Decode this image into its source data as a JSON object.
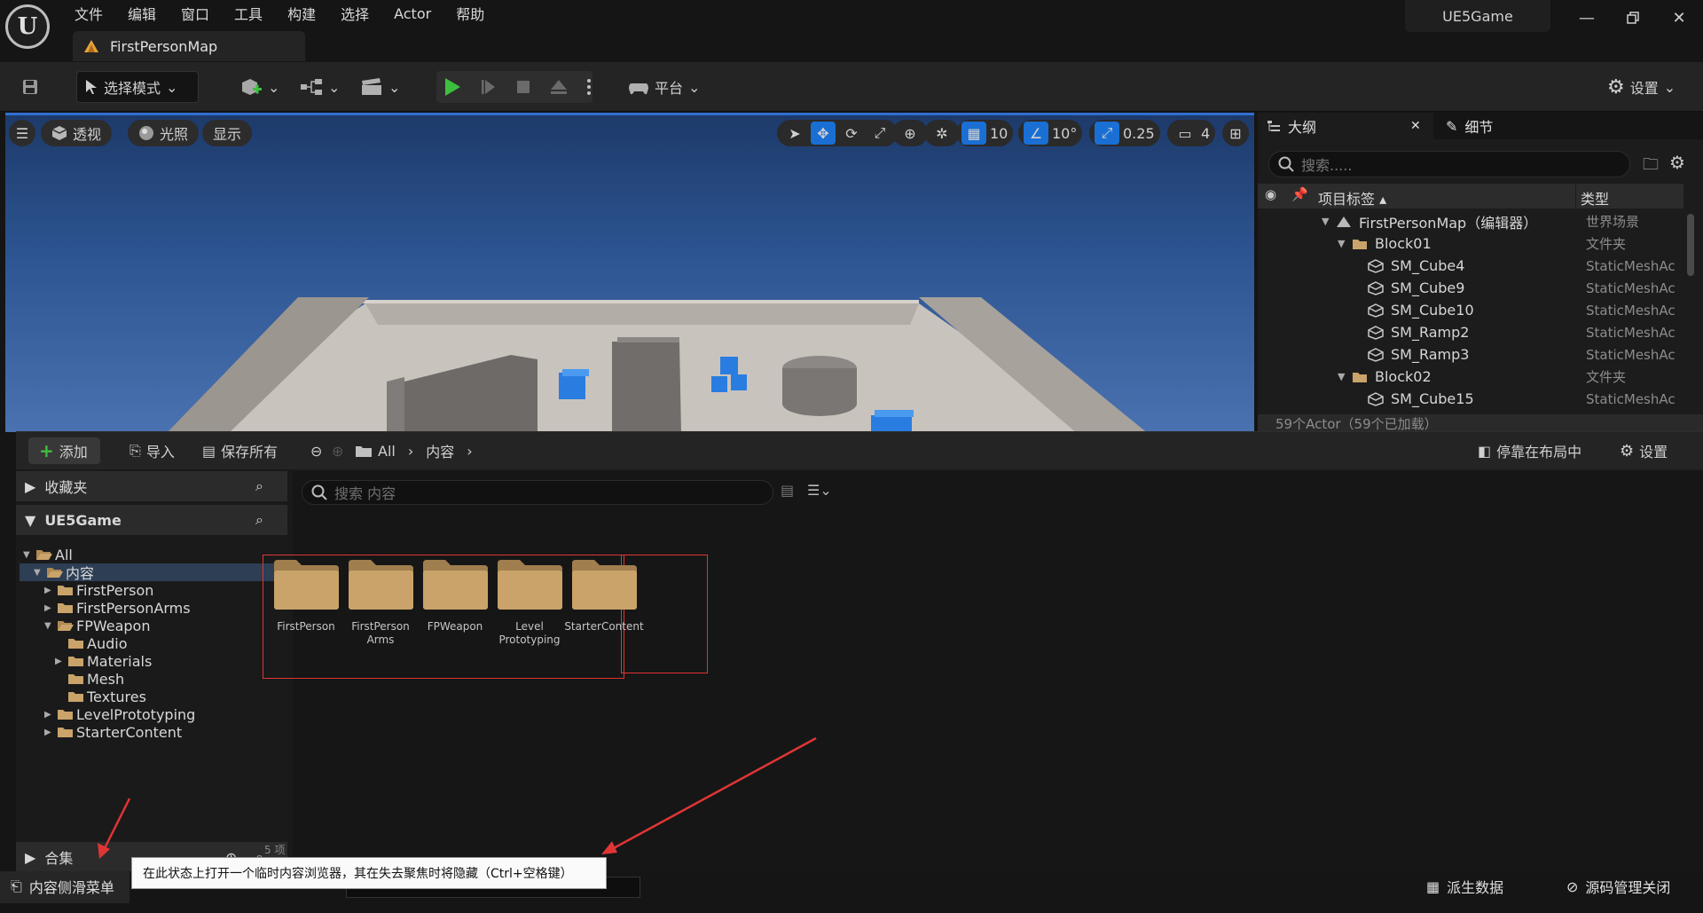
{
  "menubar": [
    "文件",
    "编辑",
    "窗口",
    "工具",
    "构建",
    "选择",
    "Actor",
    "帮助"
  ],
  "map_tab": "FirstPersonMap",
  "project_name": "UE5Game",
  "toolbar": {
    "mode_label": "选择模式",
    "platform_label": "平台",
    "settings_label": "设置"
  },
  "viewport": {
    "perspective_label": "透视",
    "lighting_label": "光照",
    "show_label": "显示",
    "grid_snap": "10",
    "rotation_snap": "10°",
    "scale_snap": "0.25",
    "camera_speed": "4"
  },
  "outliner": {
    "tab_label": "大纲",
    "details_tab_label": "细节",
    "search_placeholder": "搜索.....",
    "col_label": "项目标签 ▴",
    "col_type": "类型",
    "rows": [
      {
        "label": "FirstPersonMap（编辑器）",
        "type": "世界场景",
        "indent": 0,
        "kind": "map"
      },
      {
        "label": "Block01",
        "type": "文件夹",
        "indent": 1,
        "kind": "folder"
      },
      {
        "label": "SM_Cube4",
        "type": "StaticMeshAc",
        "indent": 2,
        "kind": "mesh"
      },
      {
        "label": "SM_Cube9",
        "type": "StaticMeshAc",
        "indent": 2,
        "kind": "mesh"
      },
      {
        "label": "SM_Cube10",
        "type": "StaticMeshAc",
        "indent": 2,
        "kind": "mesh"
      },
      {
        "label": "SM_Ramp2",
        "type": "StaticMeshAc",
        "indent": 2,
        "kind": "mesh"
      },
      {
        "label": "SM_Ramp3",
        "type": "StaticMeshAc",
        "indent": 2,
        "kind": "mesh"
      },
      {
        "label": "Block02",
        "type": "文件夹",
        "indent": 1,
        "kind": "folder"
      },
      {
        "label": "SM_Cube15",
        "type": "StaticMeshAc",
        "indent": 2,
        "kind": "mesh"
      }
    ],
    "footer": "59个Actor（59个已加载）"
  },
  "content_browser": {
    "add_label": "添加",
    "import_label": "导入",
    "save_all_label": "保存所有",
    "path": [
      "All",
      "内容"
    ],
    "dock_label": "停靠在布局中",
    "settings_label": "设置",
    "favorites_label": "收藏夹",
    "project_label": "UE5Game",
    "collections_label": "合集",
    "search_placeholder": "搜索 内容",
    "item_count": "5 项",
    "tree": [
      {
        "label": "All",
        "indent": 0,
        "arrow": "down",
        "selected": false,
        "open": true
      },
      {
        "label": "内容",
        "indent": 1,
        "arrow": "down",
        "selected": true,
        "open": true
      },
      {
        "label": "FirstPerson",
        "indent": 2,
        "arrow": "right",
        "selected": false,
        "open": false
      },
      {
        "label": "FirstPersonArms",
        "indent": 2,
        "arrow": "right",
        "selected": false,
        "open": false
      },
      {
        "label": "FPWeapon",
        "indent": 2,
        "arrow": "down",
        "selected": false,
        "open": true
      },
      {
        "label": "Audio",
        "indent": 3,
        "arrow": "",
        "selected": false,
        "open": false
      },
      {
        "label": "Materials",
        "indent": 3,
        "arrow": "right",
        "selected": false,
        "open": false
      },
      {
        "label": "Mesh",
        "indent": 3,
        "arrow": "",
        "selected": false,
        "open": false
      },
      {
        "label": "Textures",
        "indent": 3,
        "arrow": "",
        "selected": false,
        "open": false
      },
      {
        "label": "LevelPrototyping",
        "indent": 2,
        "arrow": "right",
        "selected": false,
        "open": false
      },
      {
        "label": "StarterContent",
        "indent": 2,
        "arrow": "right",
        "selected": false,
        "open": false
      }
    ],
    "assets": [
      {
        "name": "FirstPerson"
      },
      {
        "name": "FirstPerson Arms"
      },
      {
        "name": "FPWeapon"
      },
      {
        "name": "Level Prototyping"
      },
      {
        "name": "StarterContent"
      }
    ]
  },
  "statusbar": {
    "drawer_label": "内容侧滑菜单",
    "derived_data_label": "派生数据",
    "source_control_label": "源码管理关闭"
  },
  "tooltip": "在此状态上打开一个临时内容浏览器，其在失去聚焦时将隐藏（Ctrl+空格键）",
  "colors": {
    "accent_blue": "#1a6fd4",
    "folder": "#c9a36a",
    "play_green": "#3fbf3f",
    "annotation_red": "#e03535"
  }
}
